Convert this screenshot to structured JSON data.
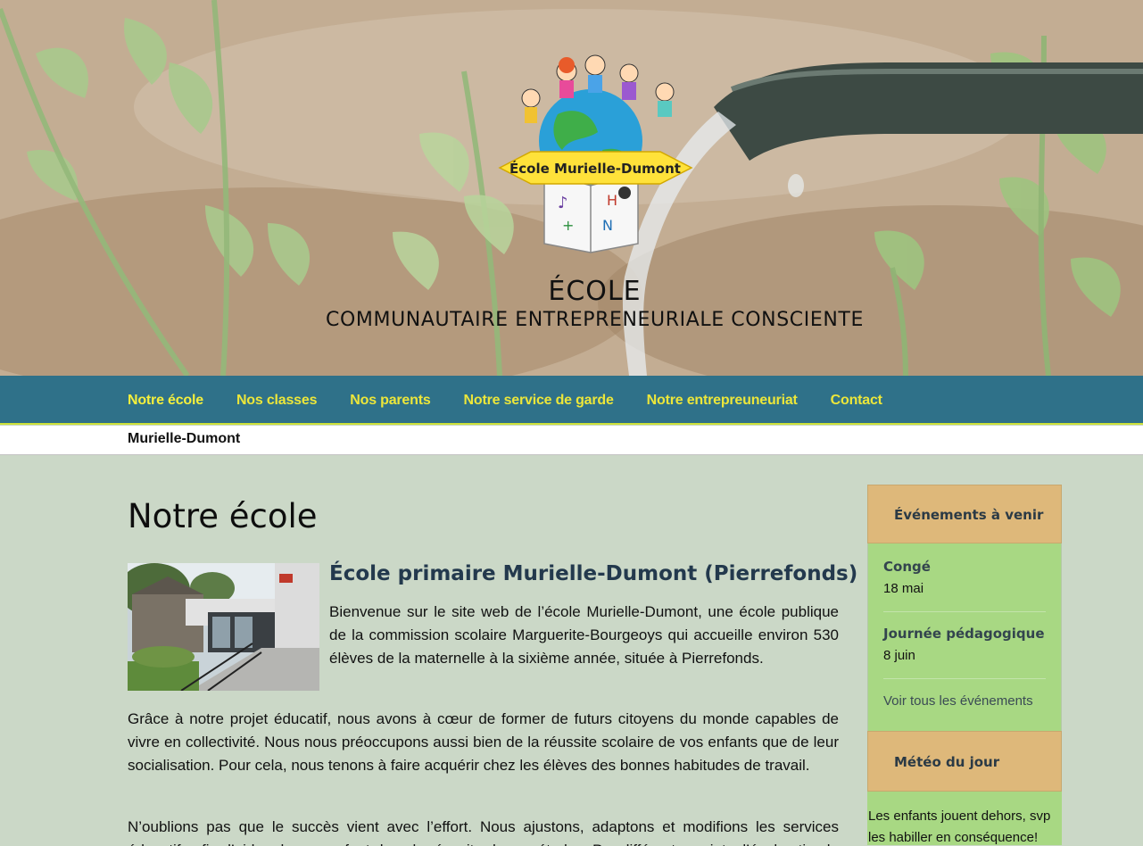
{
  "header": {
    "logo_text": "École Murielle-Dumont",
    "title": "ÉCOLE",
    "subtitle": "COMMUNAUTAIRE ENTREPRENEURIALE CONSCIENTE"
  },
  "nav": {
    "items": [
      {
        "label": "Notre école"
      },
      {
        "label": "Nos classes"
      },
      {
        "label": "Nos parents"
      },
      {
        "label": "Notre service de garde"
      },
      {
        "label": "Notre entrepreuneuriat"
      },
      {
        "label": "Contact"
      }
    ]
  },
  "breadcrumb": {
    "label": "Murielle-Dumont"
  },
  "main": {
    "title": "Notre école",
    "subtitle": "École primaire Murielle-Dumont (Pierrefonds)",
    "paragraphs": [
      "Bienvenue sur le site web de l’école Murielle-Dumont, une école publique de la commission scolaire Marguerite-Bourgeoys qui accueille environ 530 élèves de la maternelle à la sixième année, située à Pierrefonds.",
      "Grâce à notre projet éducatif, nous avons à cœur de former de futurs citoyens du monde capables de vivre en collectivité. Nous nous préoccupons aussi bien de la réussite scolaire de vos enfants que de leur socialisation.  Pour cela, nous tenons à faire acquérir chez les élèves des bonnes habitudes de travail.",
      "N’oublions pas que le succès vient avec l’effort.  Nous ajustons, adaptons et modifions les services éducatifs afin d’aider chaque enfant dans la réussite de ses études. Par différents projets, l’école stimule et..."
    ]
  },
  "sidebar": {
    "events_title": "Événements à venir",
    "events": [
      {
        "name": "Congé",
        "date": "18 mai"
      },
      {
        "name": "Journée pédagogique",
        "date": "8 juin"
      }
    ],
    "all_events_link": "Voir tous les événements",
    "weather_title": "Météo du jour",
    "weather_text": "Les enfants jouent dehors, svp les habiller en conséquence!"
  },
  "colors": {
    "nav_bg": "#2f7189",
    "nav_text": "#ece63a",
    "page_bg": "#cbd8c7",
    "sidebar_head": "#deb87a",
    "sidebar_body": "#a8d883"
  }
}
